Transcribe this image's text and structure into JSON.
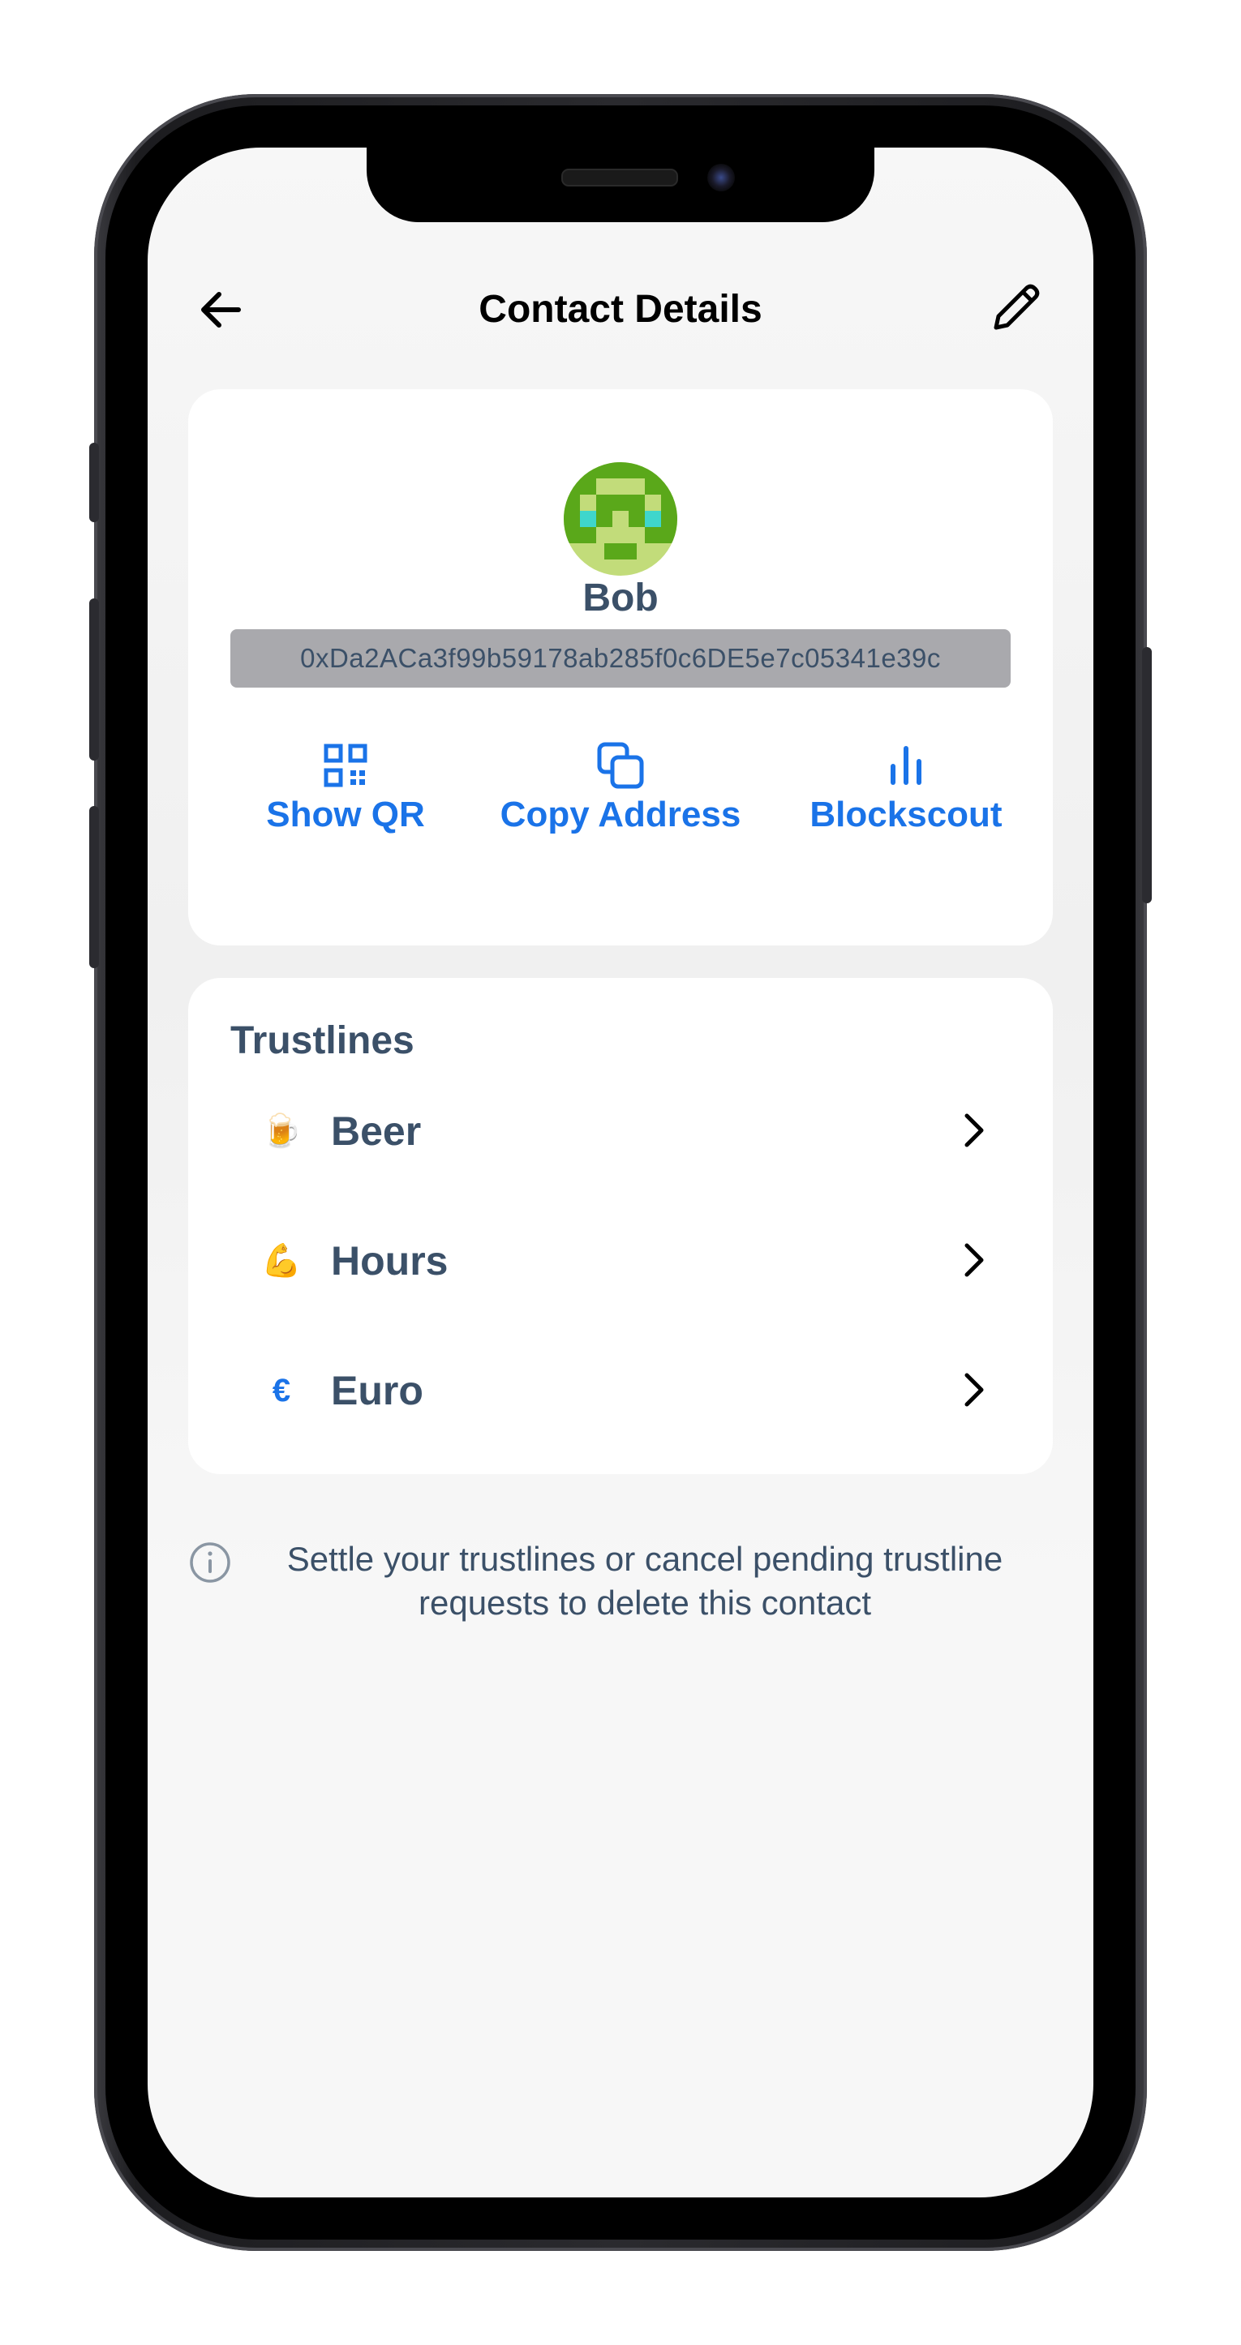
{
  "header": {
    "title": "Contact Details",
    "back_icon": "arrow-left-icon",
    "edit_icon": "pencil-icon"
  },
  "contact": {
    "name": "Bob",
    "address": "0xDa2ACa3f99b59178ab285f0c6DE5e7c05341e39c",
    "avatar_icon": "identicon-avatar",
    "avatar_colors": [
      "#c2dc7a",
      "#5aa81a",
      "#3fd6cc"
    ]
  },
  "actions": [
    {
      "label": "Show QR",
      "icon": "qr-code-icon"
    },
    {
      "label": "Copy Address",
      "icon": "copy-icon"
    },
    {
      "label": "Blockscout",
      "icon": "bar-chart-icon"
    }
  ],
  "trustlines": {
    "title": "Trustlines",
    "items": [
      {
        "label": "Beer",
        "emoji": "🍺",
        "icon": "beer-icon"
      },
      {
        "label": "Hours",
        "emoji": "💪",
        "icon": "flexed-biceps-icon"
      },
      {
        "label": "Euro",
        "emoji": "€",
        "icon": "euro-icon"
      }
    ]
  },
  "info": {
    "text": "Settle your trustlines or cancel pending trustline requests to delete this contact",
    "icon": "info-circle-icon"
  },
  "colors": {
    "accent": "#1a73e8",
    "text_primary": "#3b5068",
    "address_bg": "#a9a9ad"
  }
}
